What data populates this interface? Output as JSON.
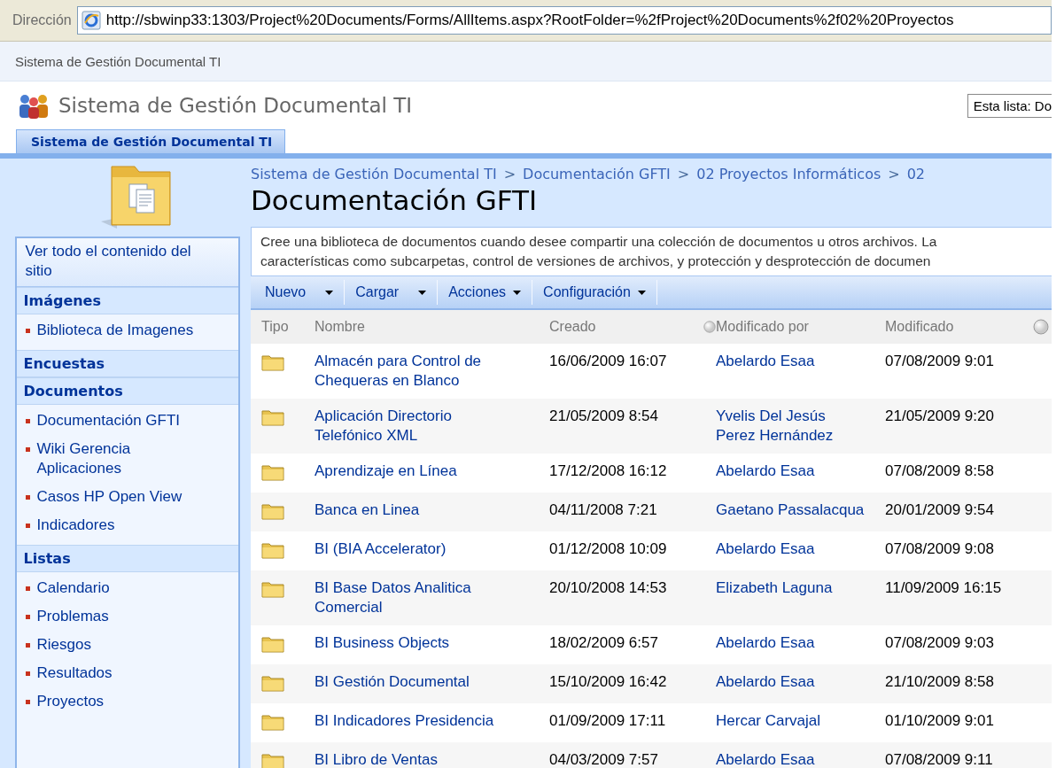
{
  "address_bar": {
    "label": "Dirección",
    "url": "http://sbwinp33:1303/Project%20Documents/Forms/AllItems.aspx?RootFolder=%2fProject%20Documents%2f02%20Proyectos"
  },
  "site_title_bar": "Sistema de Gestión Documental TI",
  "header": {
    "site_name": "Sistema de Gestión Documental TI",
    "search_scope": "Esta lista: Do",
    "tabs": [
      {
        "label": "Sistema de Gestión Documental TI",
        "selected": true
      }
    ]
  },
  "sidebar": {
    "view_all": "Ver todo el contenido del sitio",
    "sections": [
      {
        "heading": "Imágenes",
        "items": [
          "Biblioteca de Imagenes"
        ]
      },
      {
        "heading": "Encuestas"
      },
      {
        "heading": "Documentos",
        "items": [
          "Documentación GFTI",
          "Wiki Gerencia Aplicaciones",
          "Casos HP Open View",
          "Indicadores"
        ]
      },
      {
        "heading": "Listas",
        "items": [
          "Calendario",
          "Problemas",
          "Riesgos",
          "Resultados",
          "Proyectos"
        ]
      }
    ]
  },
  "breadcrumb": [
    {
      "kind": "link",
      "text": "Sistema de Gestión Documental TI"
    },
    {
      "kind": "separator",
      "text": ">"
    },
    {
      "kind": "link",
      "text": "Documentación GFTI"
    },
    {
      "kind": "separator",
      "text": ">"
    },
    {
      "kind": "link",
      "text": "02 Proyectos Informáticos"
    },
    {
      "kind": "separator",
      "text": ">"
    },
    {
      "kind": "link",
      "text": "02"
    }
  ],
  "page_title": "Documentación GFTI",
  "description": [
    "Cree una biblioteca de documentos cuando desee compartir una colección de documentos u otros archivos. La",
    "características como subcarpetas, control de versiones de archivos, y protección y desprotección de documen"
  ],
  "toolbar": [
    {
      "label": "Nuevo"
    },
    {
      "label": "Cargar"
    },
    {
      "label": "Acciones"
    },
    {
      "label": "Configuración"
    }
  ],
  "table": {
    "columns": [
      {
        "kind": "text",
        "label": "Tipo"
      },
      {
        "kind": "text",
        "label": "Nombre"
      },
      {
        "kind": "text",
        "label": "Creado"
      },
      {
        "kind": "status"
      },
      {
        "kind": "text",
        "label": "Modificado por"
      },
      {
        "kind": "text",
        "label": "Modificado"
      },
      {
        "kind": "status"
      }
    ],
    "rows": [
      {
        "name": "Almacén para Control de Chequeras en Blanco",
        "created": "16/06/2009 16:07",
        "modified_by": "Abelardo Esaa",
        "modified": "07/08/2009 9:01"
      },
      {
        "name": "Aplicación Directorio Telefónico XML",
        "created": "21/05/2009 8:54",
        "modified_by": "Yvelis Del Jesús Perez Hernández",
        "modified": "21/05/2009 9:20"
      },
      {
        "name": "Aprendizaje en Línea",
        "created": "17/12/2008 16:12",
        "modified_by": "Abelardo Esaa",
        "modified": "07/08/2009 8:58"
      },
      {
        "name": "Banca en Linea",
        "created": "04/11/2008 7:21",
        "modified_by": "Gaetano Passalacqua",
        "modified": "20/01/2009 9:54"
      },
      {
        "name": "BI (BIA Accelerator)",
        "created": "01/12/2008 10:09",
        "modified_by": "Abelardo Esaa",
        "modified": "07/08/2009 9:08"
      },
      {
        "name": "BI Base Datos Analitica Comercial",
        "created": "20/10/2008 14:53",
        "modified_by": "Elizabeth Laguna",
        "modified": "11/09/2009 16:15"
      },
      {
        "name": "BI Business Objects",
        "created": "18/02/2009 6:57",
        "modified_by": "Abelardo Esaa",
        "modified": "07/08/2009 9:03"
      },
      {
        "name": "BI Gestión Documental",
        "created": "15/10/2009 16:42",
        "modified_by": "Abelardo Esaa",
        "modified": "21/10/2009 8:58"
      },
      {
        "name": "BI Indicadores Presidencia",
        "created": "01/09/2009 17:11",
        "modified_by": "Hercar Carvajal",
        "modified": "01/10/2009 9:01"
      },
      {
        "name": "BI Libro de Ventas",
        "created": "04/03/2009 7:57",
        "modified_by": "Abelardo Esaa",
        "modified": "07/08/2009 9:11"
      }
    ]
  }
}
